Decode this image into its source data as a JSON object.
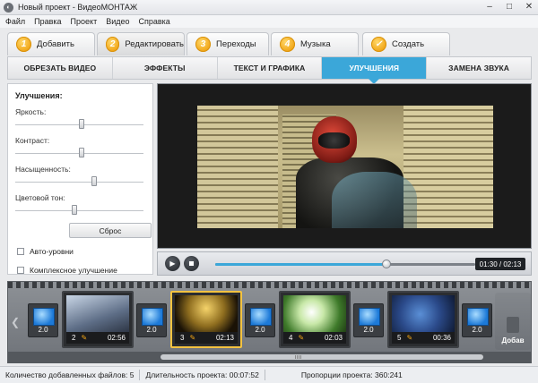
{
  "window": {
    "title": "Новый проект - ВидеоМОНТАЖ",
    "controls": [
      "–",
      "□",
      "✕"
    ]
  },
  "menu": [
    "Файл",
    "Правка",
    "Проект",
    "Видео",
    "Справка"
  ],
  "main_tabs": [
    {
      "num": "1",
      "label": "Добавить"
    },
    {
      "num": "2",
      "label": "Редактировать"
    },
    {
      "num": "3",
      "label": "Переходы"
    },
    {
      "num": "4",
      "label": "Музыка"
    },
    {
      "num": "✓",
      "label": "Создать"
    }
  ],
  "sub_tabs": [
    "ОБРЕЗАТЬ ВИДЕО",
    "ЭФФЕКТЫ",
    "ТЕКСТ И ГРАФИКА",
    "УЛУЧШЕНИЯ",
    "ЗАМЕНА ЗВУКА"
  ],
  "sub_tab_active": "УЛУЧШЕНИЯ",
  "panel": {
    "title": "Улучшения:",
    "sliders": [
      {
        "label": "Яркость:",
        "level": 0.5
      },
      {
        "label": "Контраст:",
        "level": 0.5
      },
      {
        "label": "Насыщенность:",
        "level": 0.6
      },
      {
        "label": "Цветовой тон:",
        "level": 0.45
      }
    ],
    "reset_label": "Сброс",
    "checkboxes": [
      "Авто-уровни",
      "Комплексное улучшение"
    ]
  },
  "player": {
    "progress": 0.66,
    "time": "01:30 / 02:13"
  },
  "timeline": {
    "transitions": [
      "2.0",
      "2.0",
      "2.0",
      "2.0",
      "2.0"
    ],
    "clips": [
      {
        "index": "2",
        "duration": "02:56"
      },
      {
        "index": "3",
        "duration": "02:13"
      },
      {
        "index": "4",
        "duration": "02:03"
      },
      {
        "index": "5",
        "duration": "00:36"
      }
    ],
    "add_label": "Добав"
  },
  "status": {
    "files": "Количество добавленных файлов: 5",
    "duration": "Длительность проекта:  00:07:52",
    "ratio": "Пропорции проекта:  360:241"
  },
  "colors": {
    "accent": "#3ba7d9",
    "badge": "#f1a516",
    "selected_clip": "#f4c340"
  }
}
